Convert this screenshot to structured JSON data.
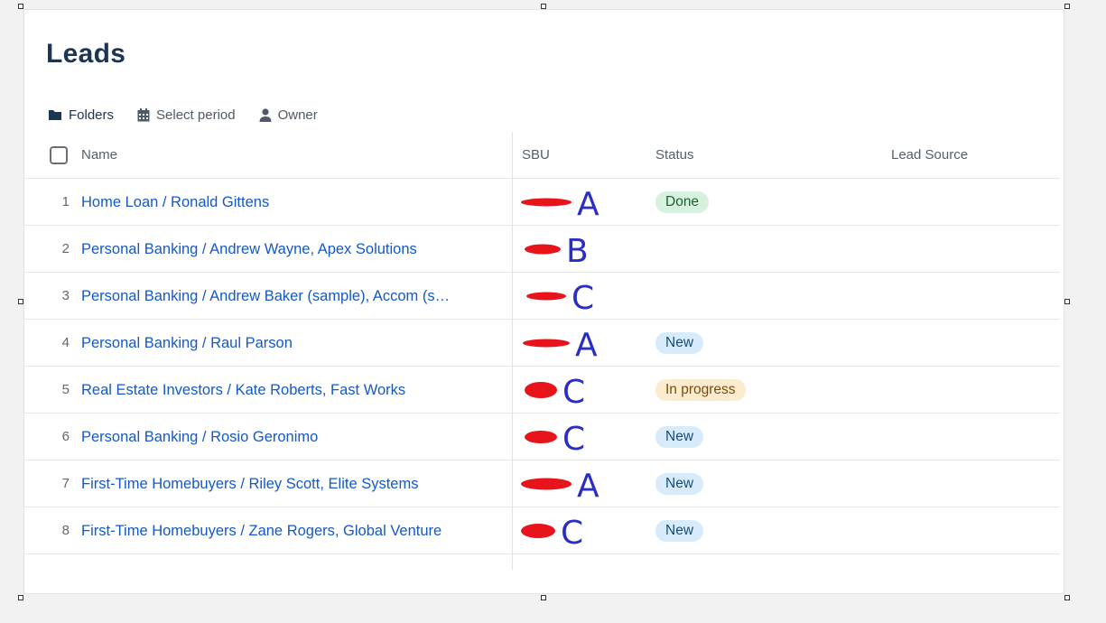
{
  "page": {
    "title": "Leads"
  },
  "toolbar": {
    "folders": "Folders",
    "period": "Select period",
    "owner": "Owner"
  },
  "columns": {
    "name": "Name",
    "sbu": "SBU",
    "status": "Status",
    "lead_source": "Lead Source"
  },
  "colors": {
    "link": "#1558c7",
    "title": "#1c3550",
    "redaction": "#e8141b",
    "annotation": "#2a2ec4",
    "done_bg": "#d6f2df",
    "new_bg": "#d7ebfa",
    "in_progress_bg": "#fbebcf"
  },
  "rows": [
    {
      "num": "1",
      "name": "Home Loan / Ronald Gittens",
      "sbu_note": "A",
      "status": "Done"
    },
    {
      "num": "2",
      "name": "Personal Banking / Andrew Wayne, Apex Solutions",
      "sbu_note": "B",
      "status": ""
    },
    {
      "num": "3",
      "name": "Personal Banking / Andrew Baker (sample), Accom (s…",
      "sbu_note": "C",
      "status": ""
    },
    {
      "num": "4",
      "name": "Personal Banking / Raul Parson",
      "sbu_note": "A",
      "status": "New"
    },
    {
      "num": "5",
      "name": "Real Estate Investors / Kate Roberts, Fast Works",
      "sbu_note": "C",
      "status": "In progress"
    },
    {
      "num": "6",
      "name": "Personal Banking / Rosio Geronimo",
      "sbu_note": "C",
      "status": "New"
    },
    {
      "num": "7",
      "name": "First-Time Homebuyers / Riley Scott, Elite Systems",
      "sbu_note": "A",
      "status": "New"
    },
    {
      "num": "8",
      "name": "First-Time Homebuyers / Zane Rogers, Global Venture",
      "sbu_note": "C",
      "status": "New"
    }
  ]
}
